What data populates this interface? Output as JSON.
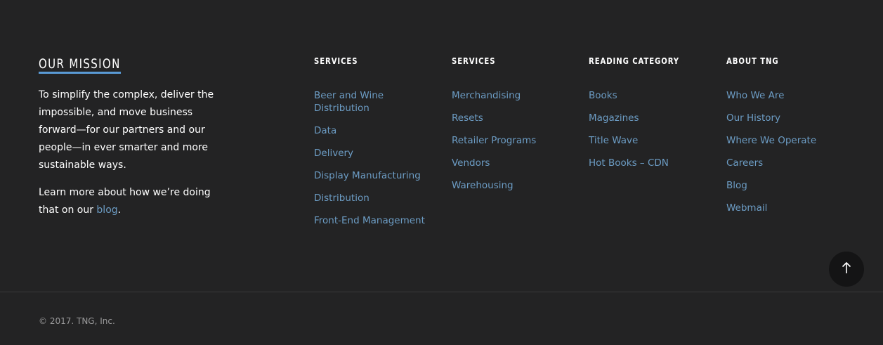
{
  "mission": {
    "title": "OUR MISSION",
    "text": "To simplify the complex, deliver the impossible, and move business forward—for our partners and our people—in ever smarter and more sustainable ways.",
    "more_prefix": "Learn more about how we’re doing that on our ",
    "more_link": "blog",
    "more_suffix": "."
  },
  "columns": [
    {
      "title": "SERVICES",
      "items": [
        "Beer and Wine Distribution",
        "Data",
        "Delivery",
        "Display Manufacturing",
        "Distribution",
        "Front-End Management"
      ]
    },
    {
      "title": "SERVICES",
      "items": [
        "Merchandising",
        "Resets",
        "Retailer Programs",
        "Vendors",
        "Warehousing"
      ]
    },
    {
      "title": "READING CATEGORY",
      "items": [
        "Books",
        "Magazines",
        "Title Wave",
        "Hot Books – CDN"
      ]
    },
    {
      "title": "ABOUT TNG",
      "items": [
        "Who We Are",
        "Our History",
        "Where We Operate",
        "Careers",
        "Blog",
        "Webmail"
      ]
    }
  ],
  "scroll_top": {
    "icon": "arrow-up-icon"
  },
  "copyright": "© 2017. TNG, Inc.",
  "colors": {
    "background": "#232324",
    "link": "#6c9cc4",
    "accent_underline": "#5a9ad6",
    "text": "#ffffff",
    "muted": "#9a9a9b"
  }
}
